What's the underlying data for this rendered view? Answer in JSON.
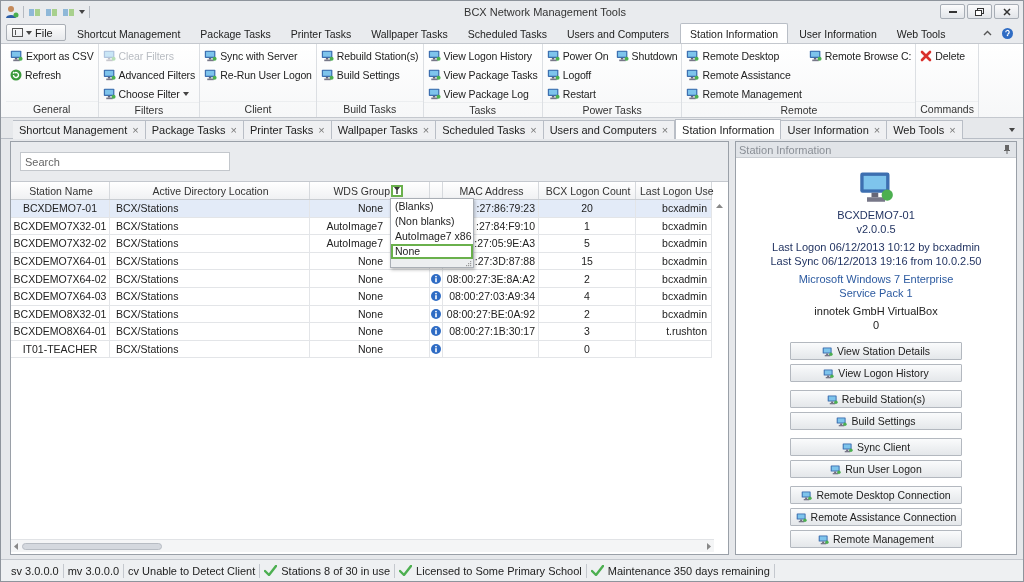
{
  "window": {
    "title": "BCX Network Management Tools"
  },
  "ribbon": {
    "file_label": "File",
    "tabs": [
      {
        "label": "Shortcut Management",
        "selected": false
      },
      {
        "label": "Package Tasks",
        "selected": false
      },
      {
        "label": "Printer Tasks",
        "selected": false
      },
      {
        "label": "Wallpaper Tasks",
        "selected": false
      },
      {
        "label": "Scheduled Tasks",
        "selected": false
      },
      {
        "label": "Users and Computers",
        "selected": false
      },
      {
        "label": "Station Information",
        "selected": true
      },
      {
        "label": "User Information",
        "selected": false
      },
      {
        "label": "Web Tools",
        "selected": false
      }
    ],
    "groups": [
      {
        "label": "General",
        "columns": [
          [
            {
              "label": "Export as CSV",
              "kind": "task",
              "disabled": false,
              "menu": false
            },
            {
              "label": "Refresh",
              "kind": "refresh",
              "disabled": false,
              "menu": false
            }
          ]
        ]
      },
      {
        "label": "Filters",
        "columns": [
          [
            {
              "label": "Clear Filters",
              "kind": "task",
              "disabled": true,
              "menu": false
            },
            {
              "label": "Advanced Filters",
              "kind": "task",
              "disabled": false,
              "menu": false
            },
            {
              "label": "Choose Filter",
              "kind": "task",
              "disabled": false,
              "menu": true
            }
          ]
        ]
      },
      {
        "label": "Client",
        "columns": [
          [
            {
              "label": "Sync with Server",
              "kind": "task",
              "disabled": false,
              "menu": false
            },
            {
              "label": "Re-Run User Logon",
              "kind": "task",
              "disabled": false,
              "menu": false
            }
          ]
        ]
      },
      {
        "label": "Build Tasks",
        "columns": [
          [
            {
              "label": "Rebuild Station(s)",
              "kind": "task",
              "disabled": false,
              "menu": false
            },
            {
              "label": "Build Settings",
              "kind": "task",
              "disabled": false,
              "menu": false
            }
          ]
        ]
      },
      {
        "label": "Tasks",
        "columns": [
          [
            {
              "label": "View Logon History",
              "kind": "task",
              "disabled": false,
              "menu": false
            },
            {
              "label": "View Package Tasks",
              "kind": "task",
              "disabled": false,
              "menu": false
            },
            {
              "label": "View Package Log",
              "kind": "task",
              "disabled": false,
              "menu": false
            }
          ]
        ]
      },
      {
        "label": "Power Tasks",
        "columns": [
          [
            {
              "label": "Power On",
              "kind": "task",
              "disabled": false,
              "menu": false
            },
            {
              "label": "Logoff",
              "kind": "task",
              "disabled": false,
              "menu": false
            },
            {
              "label": "Restart",
              "kind": "task",
              "disabled": false,
              "menu": false
            }
          ],
          [
            {
              "label": "Shutdown",
              "kind": "task",
              "disabled": false,
              "menu": false
            }
          ]
        ]
      },
      {
        "label": "Remote",
        "columns": [
          [
            {
              "label": "Remote Desktop",
              "kind": "task",
              "disabled": false,
              "menu": false
            },
            {
              "label": "Remote Assistance",
              "kind": "task",
              "disabled": false,
              "menu": false
            },
            {
              "label": "Remote Management",
              "kind": "task",
              "disabled": false,
              "menu": false
            }
          ],
          [
            {
              "label": "Remote Browse C:",
              "kind": "task",
              "disabled": false,
              "menu": false
            }
          ]
        ]
      },
      {
        "label": "Commands",
        "columns": [
          [
            {
              "label": "Delete",
              "kind": "delete",
              "disabled": false,
              "menu": false
            }
          ]
        ]
      }
    ]
  },
  "doc_tabs": [
    {
      "label": "Shortcut Management",
      "close": "×",
      "selected": false
    },
    {
      "label": "Package Tasks",
      "close": "×",
      "selected": false
    },
    {
      "label": "Printer Tasks",
      "close": "×",
      "selected": false
    },
    {
      "label": "Wallpaper Tasks",
      "close": "×",
      "selected": false
    },
    {
      "label": "Scheduled Tasks",
      "close": "×",
      "selected": false
    },
    {
      "label": "Users and Computers",
      "close": "×",
      "selected": false
    },
    {
      "label": "Station Information",
      "selected": true
    },
    {
      "label": "User Information",
      "close": "×",
      "selected": false
    },
    {
      "label": "Web Tools",
      "close": "×",
      "selected": false
    }
  ],
  "search": {
    "placeholder": "Search"
  },
  "grid": {
    "columns": [
      {
        "kind": "text",
        "label": "Station Name"
      },
      {
        "kind": "text",
        "label": "Active Directory Location"
      },
      {
        "kind": "text",
        "label": "WDS Group",
        "filter": true
      },
      {
        "kind": "icon"
      },
      {
        "kind": "text",
        "label": "MAC Address"
      },
      {
        "kind": "text",
        "label": "BCX Logon Count"
      },
      {
        "kind": "text",
        "label": "Last Logon Use"
      }
    ],
    "rows": [
      {
        "cells": [
          "BCXDEMO7-01",
          "BCX/Stations",
          "None",
          null,
          ":27:86:79:23",
          "20",
          "bcxadmin"
        ],
        "selected": true
      },
      {
        "cells": [
          "BCXDEMO7X32-01",
          "BCX/Stations",
          "AutoImage7",
          null,
          ":27:84:F9:10",
          "1",
          "bcxadmin"
        ],
        "selected": false
      },
      {
        "cells": [
          "BCXDEMO7X32-02",
          "BCX/Stations",
          "AutoImage7",
          null,
          ":27:05:9E:A3",
          "5",
          "bcxadmin"
        ],
        "selected": false
      },
      {
        "cells": [
          "BCXDEMO7X64-01",
          "BCX/Stations",
          "None",
          null,
          ":27:3D:87:88",
          "15",
          "bcxadmin"
        ],
        "selected": false
      },
      {
        "cells": [
          "BCXDEMO7X64-02",
          "BCX/Stations",
          "None",
          null,
          "08:00:27:3E:8A:A2",
          "2",
          "bcxadmin"
        ],
        "selected": false
      },
      {
        "cells": [
          "BCXDEMO7X64-03",
          "BCX/Stations",
          "None",
          null,
          "08:00:27:03:A9:34",
          "4",
          "bcxadmin"
        ],
        "selected": false
      },
      {
        "cells": [
          "BCXDEMO8X32-01",
          "BCX/Stations",
          "None",
          null,
          "08:00:27:BE:0A:92",
          "2",
          "bcxadmin"
        ],
        "selected": false
      },
      {
        "cells": [
          "BCXDEMO8X64-01",
          "BCX/Stations",
          "None",
          null,
          "08:00:27:1B:30:17",
          "3",
          "t.rushton"
        ],
        "selected": false
      },
      {
        "cells": [
          "IT01-TEACHER",
          "BCX/Stations",
          "None",
          null,
          null,
          "0",
          null
        ],
        "selected": false
      }
    ],
    "filter_popup": {
      "items": [
        {
          "label": "(Blanks)",
          "selected": false
        },
        {
          "label": "(Non blanks)",
          "selected": false
        },
        {
          "label": "AutoImage7 x86",
          "selected": false
        },
        {
          "label": "None",
          "selected": true
        }
      ]
    }
  },
  "station_panel": {
    "title": "Station Information",
    "blocks": [
      [
        "BCXDEMO7-01",
        "v2.0.0.5"
      ],
      [
        "Last Logon 06/12/2013 10:12 by bcxadmin",
        "Last Sync 06/12/2013 19:16 from 10.0.2.50"
      ],
      [
        "Microsoft Windows 7 Enterprise",
        "Service Pack 1"
      ],
      [
        "innotek GmbH VirtualBox",
        "0"
      ]
    ],
    "button_groups": [
      [
        "View Station Details",
        "View Logon History"
      ],
      [
        "Rebuild Station(s)",
        "Build Settings"
      ],
      [
        "Sync Client",
        "Run User Logon"
      ],
      [
        "Remote Desktop Connection",
        "Remote Assistance Connection",
        "Remote Management"
      ]
    ]
  },
  "status_bar": [
    {
      "text": "sv 3.0.0.0",
      "ok": false
    },
    {
      "text": "mv 3.0.0.0",
      "ok": false
    },
    {
      "text": "cv Unable to Detect Client",
      "ok": false
    },
    {
      "text": "Stations 8 of 30 in use",
      "ok": true
    },
    {
      "text": "Licensed to Some Primary School",
      "ok": true
    },
    {
      "text": "Maintenance 350 days remaining",
      "ok": true
    }
  ]
}
